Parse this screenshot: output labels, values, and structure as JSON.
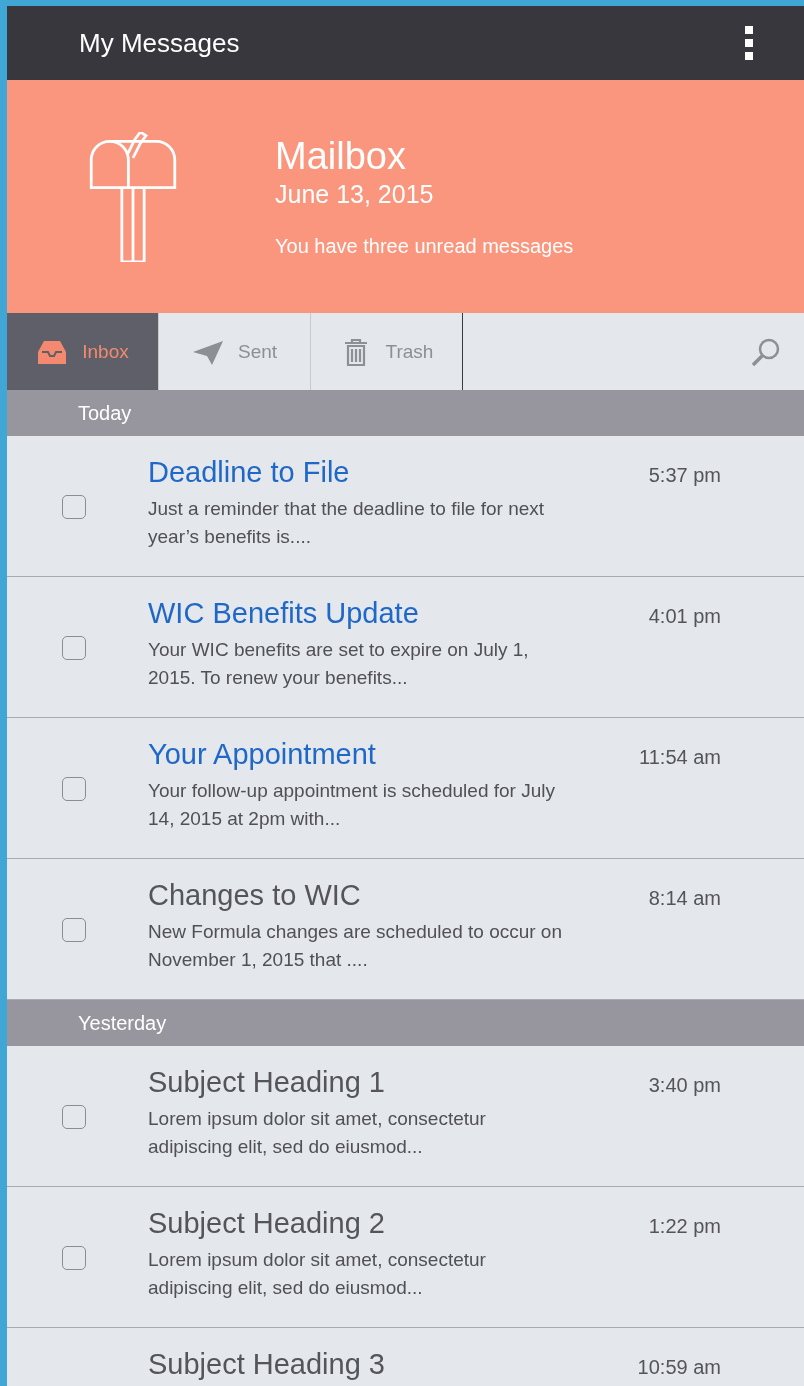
{
  "app_bar": {
    "title": "My Messages"
  },
  "hero": {
    "title": "Mailbox",
    "date": "June 13, 2015",
    "summary": "You have three unread messages"
  },
  "tabs": [
    {
      "label": "Inbox",
      "kind": "inbox",
      "selected": true
    },
    {
      "label": "Sent",
      "kind": "sent",
      "selected": false
    },
    {
      "label": "Trash",
      "kind": "trash",
      "selected": false
    }
  ],
  "sections": [
    {
      "label": "Today",
      "messages": [
        {
          "subject": "Deadline to File",
          "preview": "Just a reminder that the deadline to file for next year’s benefits is....",
          "time": "5:37 pm",
          "unread": true,
          "checked": false
        },
        {
          "subject": "WIC Benefits Update",
          "preview": "Your WIC benefits are set to expire on July 1, 2015. To renew your benefits...",
          "time": "4:01 pm",
          "unread": true,
          "checked": false
        },
        {
          "subject": "Your Appointment",
          "preview": "Your follow-up appointment is scheduled for July 14, 2015 at 2pm with...",
          "time": "11:54 am",
          "unread": true,
          "checked": false
        },
        {
          "subject": "Changes to WIC",
          "preview": "New Formula changes are scheduled to occur on November 1, 2015 that ....",
          "time": "8:14 am",
          "unread": false,
          "checked": false
        }
      ]
    },
    {
      "label": "Yesterday",
      "messages": [
        {
          "subject": "Subject Heading 1",
          "preview": "Lorem ipsum dolor sit amet, consectetur adipiscing elit, sed do eiusmod...",
          "time": "3:40 pm",
          "unread": false,
          "checked": false
        },
        {
          "subject": "Subject Heading 2",
          "preview": "Lorem ipsum dolor sit amet, consectetur adipiscing elit, sed do eiusmod...",
          "time": "1:22 pm",
          "unread": false,
          "checked": false
        },
        {
          "subject": "Subject Heading 3",
          "time": "10:59 am",
          "unread": false
        }
      ]
    }
  ]
}
